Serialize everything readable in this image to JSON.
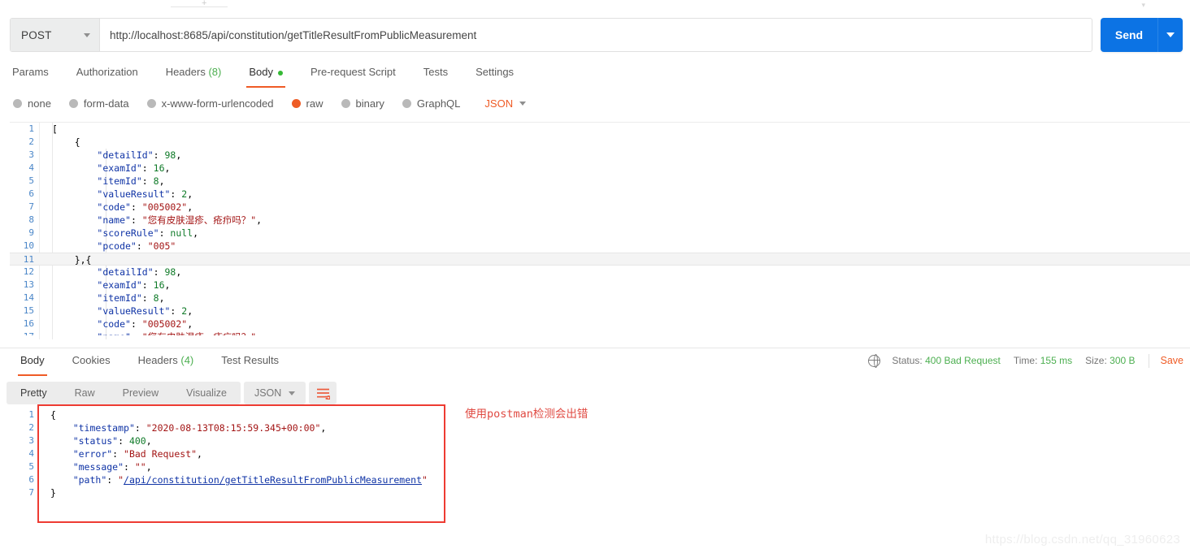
{
  "window": {
    "method": "POST",
    "url": "http://localhost:8685/api/constitution/getTitleResultFromPublicMeasurement",
    "send_label": "Send"
  },
  "request_tabs": [
    {
      "label": "Params",
      "count": "",
      "active": false,
      "dot": false
    },
    {
      "label": "Authorization",
      "count": "",
      "active": false,
      "dot": false
    },
    {
      "label": "Headers",
      "count": "(8)",
      "active": false,
      "dot": false
    },
    {
      "label": "Body",
      "count": "",
      "active": true,
      "dot": true
    },
    {
      "label": "Pre-request Script",
      "count": "",
      "active": false,
      "dot": false
    },
    {
      "label": "Tests",
      "count": "",
      "active": false,
      "dot": false
    },
    {
      "label": "Settings",
      "count": "",
      "active": false,
      "dot": false
    }
  ],
  "body_types": [
    {
      "label": "none",
      "selected": false
    },
    {
      "label": "form-data",
      "selected": false
    },
    {
      "label": "x-www-form-urlencoded",
      "selected": false
    },
    {
      "label": "raw",
      "selected": true
    },
    {
      "label": "binary",
      "selected": false
    },
    {
      "label": "GraphQL",
      "selected": false
    }
  ],
  "body_format": "JSON",
  "request_body_lines": [
    {
      "n": "1",
      "code": "["
    },
    {
      "n": "2",
      "code": "    {"
    },
    {
      "n": "3",
      "code": "        \"detailId\": 98,"
    },
    {
      "n": "4",
      "code": "        \"examId\": 16,"
    },
    {
      "n": "5",
      "code": "        \"itemId\": 8,"
    },
    {
      "n": "6",
      "code": "        \"valueResult\": 2,"
    },
    {
      "n": "7",
      "code": "        \"code\": \"005002\","
    },
    {
      "n": "8",
      "code": "        \"name\": \"您有皮肤湿疹、疮疖吗？\","
    },
    {
      "n": "9",
      "code": "        \"scoreRule\": null,"
    },
    {
      "n": "10",
      "code": "        \"pcode\": \"005\""
    },
    {
      "n": "11",
      "code": "    },{"
    },
    {
      "n": "12",
      "code": "        \"detailId\": 98,"
    },
    {
      "n": "13",
      "code": "        \"examId\": 16,"
    },
    {
      "n": "14",
      "code": "        \"itemId\": 8,"
    },
    {
      "n": "15",
      "code": "        \"valueResult\": 2,"
    },
    {
      "n": "16",
      "code": "        \"code\": \"005002\","
    }
  ],
  "response_tabs": [
    {
      "label": "Body",
      "count": "",
      "active": true
    },
    {
      "label": "Cookies",
      "count": "",
      "active": false
    },
    {
      "label": "Headers",
      "count": "(4)",
      "active": false
    },
    {
      "label": "Test Results",
      "count": "",
      "active": false
    }
  ],
  "response_meta": {
    "status_label": "Status:",
    "status_value": "400 Bad Request",
    "time_label": "Time:",
    "time_value": "155 ms",
    "size_label": "Size:",
    "size_value": "300 B",
    "save_label": "Save"
  },
  "response_format_tabs": [
    {
      "label": "Pretty",
      "active": true
    },
    {
      "label": "Raw",
      "active": false
    },
    {
      "label": "Preview",
      "active": false
    },
    {
      "label": "Visualize",
      "active": false
    }
  ],
  "response_format": "JSON",
  "response_body_lines": [
    {
      "n": "1",
      "code": "{"
    },
    {
      "n": "2",
      "code": "    \"timestamp\": \"2020-08-13T08:15:59.345+00:00\","
    },
    {
      "n": "3",
      "code": "    \"status\": 400,"
    },
    {
      "n": "4",
      "code": "    \"error\": \"Bad Request\","
    },
    {
      "n": "5",
      "code": "    \"message\": \"\","
    },
    {
      "n": "6",
      "code": "    \"path\": \"/api/constitution/getTitleResultFromPublicMeasurement\""
    },
    {
      "n": "7",
      "code": "}"
    }
  ],
  "annotation": "使用postman检测会出错",
  "watermark": "https://blog.csdn.net/qq_31960623",
  "colors": {
    "accent_orange": "#ef5b25",
    "send_blue": "#0c73e4",
    "status_green": "#4caf50",
    "annotation_red": "#e04a42",
    "box_red": "#ee3b32"
  }
}
